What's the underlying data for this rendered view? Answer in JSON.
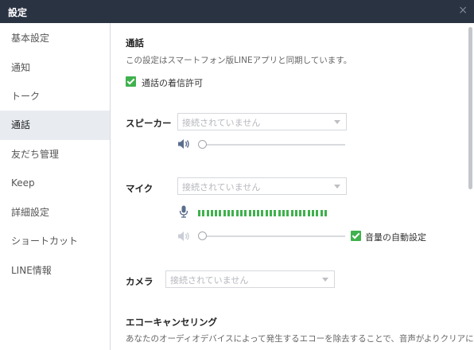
{
  "window": {
    "title": "設定",
    "close_glyph": "×"
  },
  "sidebar": {
    "items": [
      {
        "label": "基本設定"
      },
      {
        "label": "通知"
      },
      {
        "label": "トーク"
      },
      {
        "label": "通話",
        "active": true
      },
      {
        "label": "友だち管理"
      },
      {
        "label": "Keep"
      },
      {
        "label": "詳細設定"
      },
      {
        "label": "ショートカット"
      },
      {
        "label": "LINE情報"
      }
    ]
  },
  "main": {
    "section_title": "通話",
    "sync_note": "この設定はスマートフォン版LINEアプリと同期しています。",
    "allow_incoming": {
      "label": "通話の着信許可",
      "checked": true
    },
    "speaker": {
      "label": "スピーカー",
      "device": "接続されていません",
      "volume": 0
    },
    "mic": {
      "label": "マイク",
      "device": "接続されていません",
      "input_level_segments": 31,
      "volume": 0,
      "auto_volume": {
        "label": "音量の自動設定",
        "checked": true
      }
    },
    "camera": {
      "label": "カメラ",
      "device": "接続されていません"
    },
    "echo": {
      "title": "エコーキャンセリング",
      "note": "あなたのオーディオデバイスによって発生するエコーを除去することで、音声がよりクリアに伝わります。"
    }
  },
  "colors": {
    "titlebar": "#2a3342",
    "accent_green": "#3fb14d",
    "active_item_bg": "#e8ebf0"
  },
  "icons": {
    "speaker": "speaker-icon",
    "mic": "microphone-icon",
    "close": "close-icon",
    "dropdown": "chevron-down-icon"
  }
}
